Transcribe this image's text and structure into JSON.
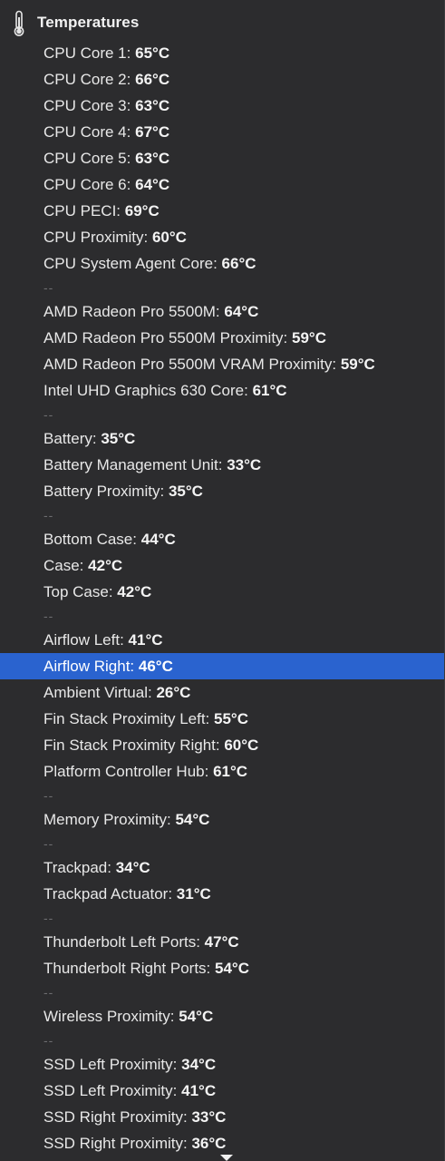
{
  "header": {
    "icon": "thermometer-icon",
    "title": "Temperatures"
  },
  "rows": [
    {
      "type": "item",
      "label": "CPU Core 1:",
      "value": "65°C"
    },
    {
      "type": "item",
      "label": "CPU Core 2:",
      "value": "66°C"
    },
    {
      "type": "item",
      "label": "CPU Core 3:",
      "value": "63°C"
    },
    {
      "type": "item",
      "label": "CPU Core 4:",
      "value": "67°C"
    },
    {
      "type": "item",
      "label": "CPU Core 5:",
      "value": "63°C"
    },
    {
      "type": "item",
      "label": "CPU Core 6:",
      "value": "64°C"
    },
    {
      "type": "item",
      "label": "CPU PECI:",
      "value": "69°C"
    },
    {
      "type": "item",
      "label": "CPU Proximity:",
      "value": "60°C"
    },
    {
      "type": "item",
      "label": "CPU System Agent Core:",
      "value": "66°C"
    },
    {
      "type": "sep",
      "text": "--"
    },
    {
      "type": "item",
      "label": "AMD Radeon Pro 5500M:",
      "value": "64°C"
    },
    {
      "type": "item",
      "label": "AMD Radeon Pro 5500M Proximity:",
      "value": "59°C"
    },
    {
      "type": "item",
      "label": "AMD Radeon Pro 5500M VRAM Proximity:",
      "value": "59°C"
    },
    {
      "type": "item",
      "label": "Intel UHD Graphics 630 Core:",
      "value": "61°C"
    },
    {
      "type": "sep",
      "text": "--"
    },
    {
      "type": "item",
      "label": "Battery:",
      "value": "35°C"
    },
    {
      "type": "item",
      "label": "Battery Management Unit:",
      "value": "33°C"
    },
    {
      "type": "item",
      "label": "Battery Proximity:",
      "value": "35°C"
    },
    {
      "type": "sep",
      "text": "--"
    },
    {
      "type": "item",
      "label": "Bottom Case:",
      "value": "44°C"
    },
    {
      "type": "item",
      "label": "Case:",
      "value": "42°C"
    },
    {
      "type": "item",
      "label": "Top Case:",
      "value": "42°C"
    },
    {
      "type": "sep",
      "text": "--"
    },
    {
      "type": "item",
      "label": "Airflow Left:",
      "value": "41°C"
    },
    {
      "type": "item",
      "label": "Airflow Right:",
      "value": "46°C",
      "selected": true
    },
    {
      "type": "item",
      "label": "Ambient Virtual:",
      "value": "26°C"
    },
    {
      "type": "item",
      "label": "Fin Stack Proximity Left:",
      "value": "55°C"
    },
    {
      "type": "item",
      "label": "Fin Stack Proximity Right:",
      "value": "60°C"
    },
    {
      "type": "item",
      "label": "Platform Controller Hub:",
      "value": "61°C"
    },
    {
      "type": "sep",
      "text": "--"
    },
    {
      "type": "item",
      "label": "Memory Proximity:",
      "value": "54°C"
    },
    {
      "type": "sep",
      "text": "--"
    },
    {
      "type": "item",
      "label": "Trackpad:",
      "value": "34°C"
    },
    {
      "type": "item",
      "label": "Trackpad Actuator:",
      "value": "31°C"
    },
    {
      "type": "sep",
      "text": "--"
    },
    {
      "type": "item",
      "label": "Thunderbolt Left Ports:",
      "value": "47°C"
    },
    {
      "type": "item",
      "label": "Thunderbolt Right Ports:",
      "value": "54°C"
    },
    {
      "type": "sep",
      "text": "--"
    },
    {
      "type": "item",
      "label": "Wireless Proximity:",
      "value": "54°C"
    },
    {
      "type": "sep",
      "text": "--"
    },
    {
      "type": "item",
      "label": "SSD Left Proximity:",
      "value": "34°C"
    },
    {
      "type": "item",
      "label": "SSD Left Proximity:",
      "value": "41°C"
    },
    {
      "type": "item",
      "label": "SSD Right Proximity:",
      "value": "33°C"
    },
    {
      "type": "item",
      "label": "SSD Right Proximity:",
      "value": "36°C"
    }
  ],
  "scroll_indicator": "scroll-down-arrow-icon",
  "colors": {
    "background": "#2c2c2e",
    "selection": "#2a63cf",
    "text": "#e8e8e8",
    "separator": "#6d6d70"
  }
}
